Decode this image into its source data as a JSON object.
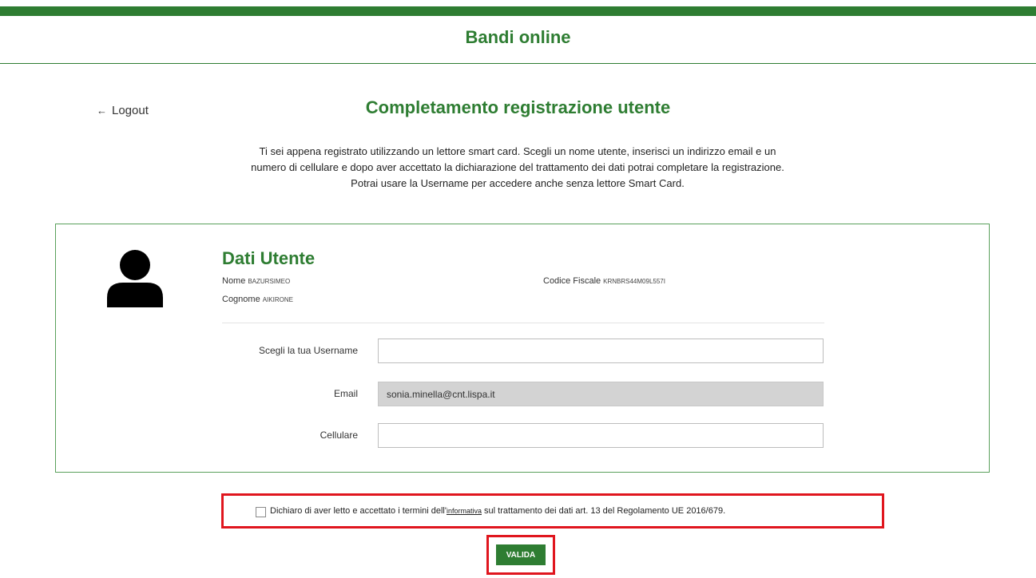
{
  "header": {
    "app_title": "Bandi online"
  },
  "nav": {
    "logout_label": "Logout",
    "logout_arrow": "←"
  },
  "page": {
    "title": "Completamento registrazione utente",
    "intro": [
      "Ti sei appena registrato utilizzando un lettore smart card. Scegli un nome utente, inserisci un indirizzo email e un",
      "numero di cellulare e dopo aver accettato la dichiarazione del trattamento dei dati potrai completare la registrazione.",
      "Potrai usare la Username per accedere anche senza lettore Smart Card."
    ]
  },
  "user_card": {
    "title": "Dati Utente",
    "nome_label": "Nome",
    "nome_value": "BAZURSIMEO",
    "cognome_label": "Cognome",
    "cognome_value": "AIKIRONE",
    "cf_label": "Codice Fiscale",
    "cf_value": "KRNBRS44M09L557I"
  },
  "form": {
    "username": {
      "label": "Scegli la tua Username",
      "value": "",
      "placeholder": ""
    },
    "email": {
      "label": "Email",
      "value": "sonia.minella@cnt.lispa.it"
    },
    "cellulare": {
      "label": "Cellulare",
      "value": "",
      "placeholder": ""
    }
  },
  "consent": {
    "checked": false,
    "text_before": "Dichiaro di aver letto e accettato i termini dell'",
    "link_text": "informativa",
    "text_after": " sul trattamento dei dati art. 13 del Regolamento UE 2016/679."
  },
  "submit": {
    "label": "VALIDA"
  },
  "colors": {
    "brand_green": "#2e7d32",
    "highlight_red": "#e0161e",
    "readonly_gray": "#d3d3d3"
  },
  "icons": {
    "avatar": "user-silhouette-icon",
    "logout": "arrow-left-icon"
  }
}
